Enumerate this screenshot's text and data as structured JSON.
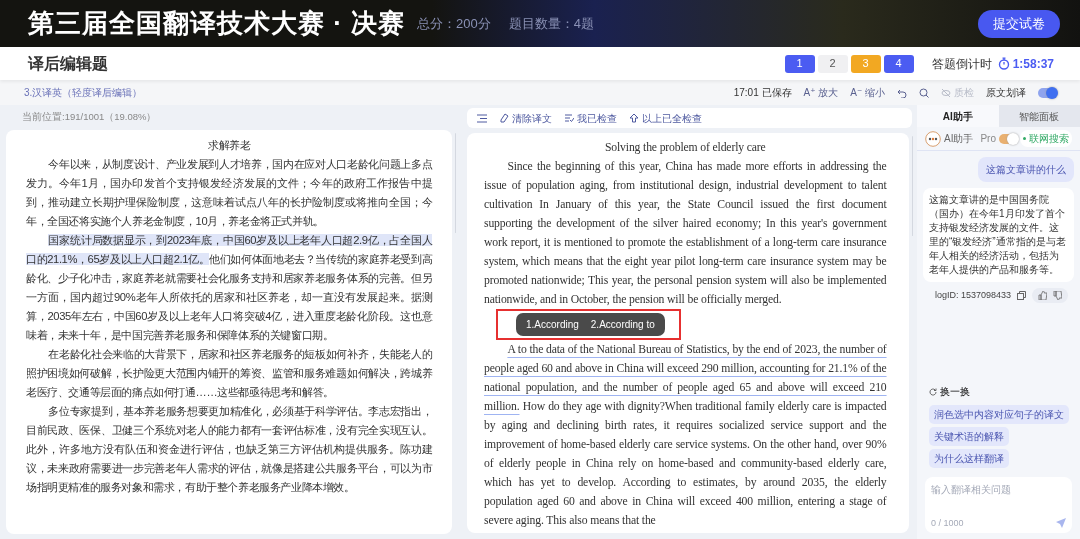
{
  "header": {
    "title": "第三届全国翻译技术大赛 · 决赛",
    "total_score": "总分：200分",
    "question_count": "题目数量：4题",
    "submit_button": "提交试卷"
  },
  "title_bar": {
    "title": "译后编辑题",
    "questions": [
      {
        "label": "1",
        "answered": true,
        "selected": false
      },
      {
        "label": "2",
        "answered": false,
        "selected": false
      },
      {
        "label": "3",
        "answered": false,
        "selected": true
      },
      {
        "label": "4",
        "answered": true,
        "selected": false
      }
    ],
    "countdown_label": "答题倒计时",
    "countdown": "1:58:37"
  },
  "sub_bar": {
    "question_title": "3.汉译英（轻度译后编辑）",
    "saved": "17:01 已保存",
    "zoom_in": {
      "icon": "A⁺",
      "label": "放大"
    },
    "zoom_out": {
      "icon": "A⁻",
      "label": "缩小"
    },
    "quality_check": {
      "label": "质检",
      "disabled": true
    },
    "selection_translate": {
      "label": "原文划译",
      "on": true
    }
  },
  "source": {
    "position": "当前位置:191/1001（19.08%）",
    "title": "求解养老",
    "paragraphs": [
      [
        {
          "text": "今年以来，从制度设计、产业发展到人才培养，国内在应对人口老龄化问题上多点发力。今年1月，国办印发首个支持银发经济发展的文件；今年的政府工作报告中提到，推动建立长期护理保险制度，这意味着试点八年的长护险制度或将推向全国；今年，全国还将实施个人养老金制度，10月，养老金将正式并轨。",
          "highlighted": false
        }
      ],
      [
        {
          "text": "国家统计局数据显示，到2023年底，中国60岁及以上老年人口超2.9亿，占全国人口的21.1%，65岁及以上人口超2.1亿。",
          "highlighted": true
        },
        {
          "text": "他们如何体面地老去？当传统的家庭养老受到高龄化、少子化冲击，家庭养老就需要社会化服务支持和居家养老服务体系的完善。但另一方面，国内超过90%老年人所依托的居家和社区养老，却一直没有发展起来。据测算，2035年左右，中国60岁及以上老年人口将突破4亿，进入重度老龄化阶段。这也意味着，未来十年，是中国完善养老服务和保障体系的关键窗口期。",
          "highlighted": false
        }
      ],
      [
        {
          "text": "在老龄化社会来临的大背景下，居家和社区养老服务的短板如何补齐，失能老人的照护困境如何破解，长护险更大范围内铺开的筹资、监管和服务难题如何解决，跨城养老医疗、交通等层面的痛点如何打通……这些都亟待思考和解答。",
          "highlighted": false
        }
      ],
      [
        {
          "text": "多位专家提到，基本养老服务想要更加精准化，必须基于科学评估。李志宏指出，目前民政、医保、卫健三个系统对老人的能力都有一套评估标准，没有完全实现互认。此外，许多地方没有队伍和资金进行评估，也缺乏第三方评估机构提供服务。陈功建议，未来政府需要进一步完善老年人需求的评估，就像是搭建公共服务平台，可以为市场指明更精准的服务对象和需求，有助于整个养老服务产业降本增效。",
          "highlighted": false
        }
      ]
    ]
  },
  "target": {
    "toolbar": [
      "清除译文",
      "我已检查",
      "以上已全检查"
    ],
    "title": "Solving the problem of elderly care",
    "paragraphs": [
      [
        {
          "text": "Since the beginning of this year, China has made more efforts in addressing the issue of population aging, from institutional design, industrial development to talent cultivation In January of this year, the State Council issued the first document supporting the development of the silver haired economy; In this year's government work report, it is mentioned to promote the establishment of a long-term care insurance system, which means that the eight year pilot long-term care insurance system may be promoted nationwide; This year, the personal pension system will also be implemented nationwide, and in October, the pension will be officially merged.",
          "highlighted": false
        }
      ],
      [
        {
          "text": "A to the data of the National Bureau of Statistics, by the end of 2023, the number of people aged 60 and above in China will exceed 290 million, accounting for 21.1% of the national population, and the number of people aged 65 and above will exceed 210 million.",
          "highlighted": true
        },
        {
          "text": " How do they age with dignity?When traditional family elderly care is impacted by aging and declining birth rates, it requires socialized service support and the improvement of home-based elderly care service systems. On the other hand, over 90% of elderly people in China rely on home-based and community-based elderly care, which has yet to develop. According to estimates, by around 2035, the elderly population aged 60 and above in China will exceed 400 million, entering a stage of severe aging. This also means that the",
          "highlighted": false
        }
      ]
    ],
    "suggestions_popup": [
      "1.According",
      "2.According to"
    ]
  },
  "assistant": {
    "tabs": [
      {
        "label": "AI助手",
        "selected": true
      },
      {
        "label": "智能面板",
        "selected": false
      }
    ],
    "name": "AI助手",
    "pro": {
      "label": "Pro",
      "on": true
    },
    "web_search": "联网搜索",
    "messages": [
      {
        "kind": "user",
        "text": "这篇文章讲的什么"
      },
      {
        "kind": "assistant",
        "text": "这篇文章讲的是中国国务院（国办）在今年1月印发了首个支持银发经济发展的文件。这里的“银发经济”通常指的是与老年人相关的经济活动，包括为老年人提供的产品和服务等。",
        "log_id": "logID: 1537098433"
      }
    ],
    "refresh": "换一换",
    "prompts": [
      "润色选中内容对应句子的译文",
      "关键术语的解释",
      "为什么这样翻译"
    ],
    "input": {
      "placeholder": "输入翻译相关问题",
      "counter": "0 / 1000"
    }
  }
}
